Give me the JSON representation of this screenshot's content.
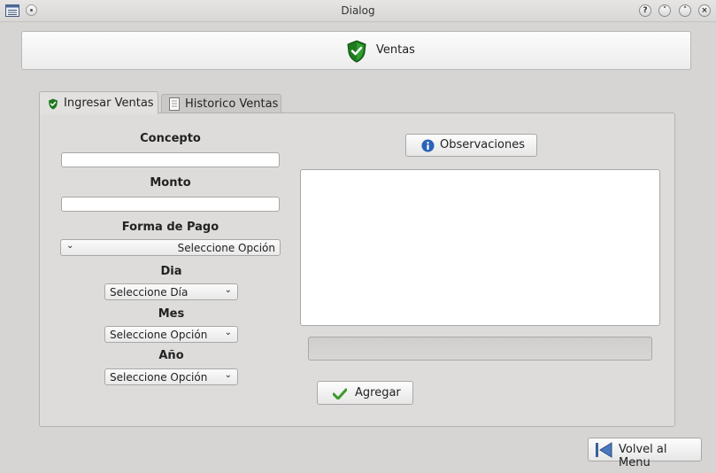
{
  "window": {
    "title": "Dialog",
    "buttons": [
      "?",
      "˅",
      "˄",
      "×"
    ]
  },
  "header": {
    "title": "Ventas"
  },
  "tabs": [
    {
      "label": "Ingresar Ventas",
      "active": true
    },
    {
      "label": "Historico Ventas",
      "active": false
    }
  ],
  "form": {
    "concepto_label": "Concepto",
    "concepto_value": "",
    "monto_label": "Monto",
    "monto_value": "",
    "forma_pago_label": "Forma de Pago",
    "forma_pago_selected": "Seleccione Opción",
    "dia_label": "Dia",
    "dia_selected": "Seleccione Día",
    "mes_label": "Mes",
    "mes_selected": "Seleccione Opción",
    "anio_label": "Año",
    "anio_selected": "Seleccione Opción"
  },
  "observaciones": {
    "button_label": "Observaciones",
    "text": ""
  },
  "actions": {
    "agregar_label": "Agregar",
    "volver_label": "Volvel al Menu"
  },
  "colors": {
    "shield_green": "#2aa12a",
    "info_blue": "#2a63b8",
    "check_green": "#3a9a2a"
  }
}
